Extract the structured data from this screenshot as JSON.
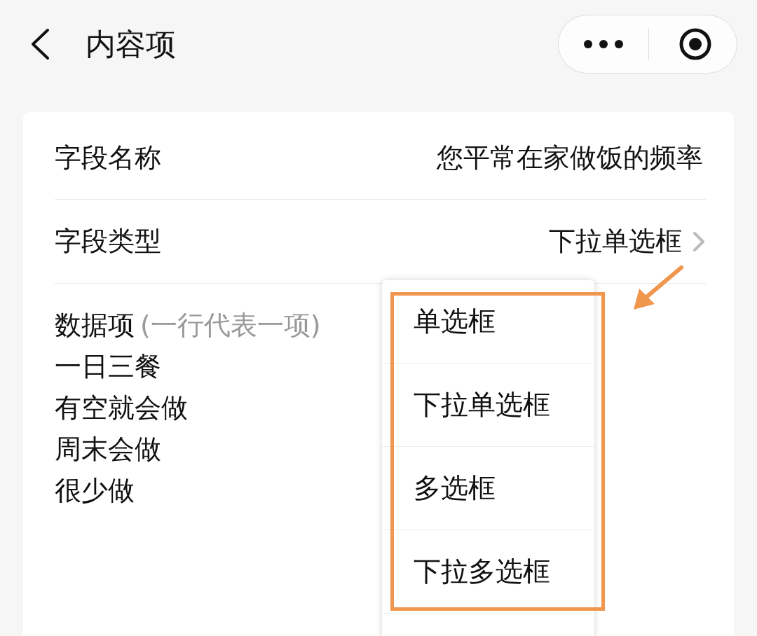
{
  "header": {
    "title": "内容项"
  },
  "fields": [
    {
      "label": "字段名称",
      "value": "您平常在家做饭的频率",
      "kind": "text"
    },
    {
      "label": "字段类型",
      "value": "下拉单选框",
      "kind": "select"
    }
  ],
  "data_items": {
    "label": "数据项",
    "hint": "(一行代表一项)",
    "lines": [
      "一日三餐",
      "有空就会做",
      "周末会做",
      "很少做"
    ]
  },
  "dropdown": {
    "options": [
      "单选框",
      "下拉单选框",
      "多选框",
      "下拉多选框"
    ]
  }
}
